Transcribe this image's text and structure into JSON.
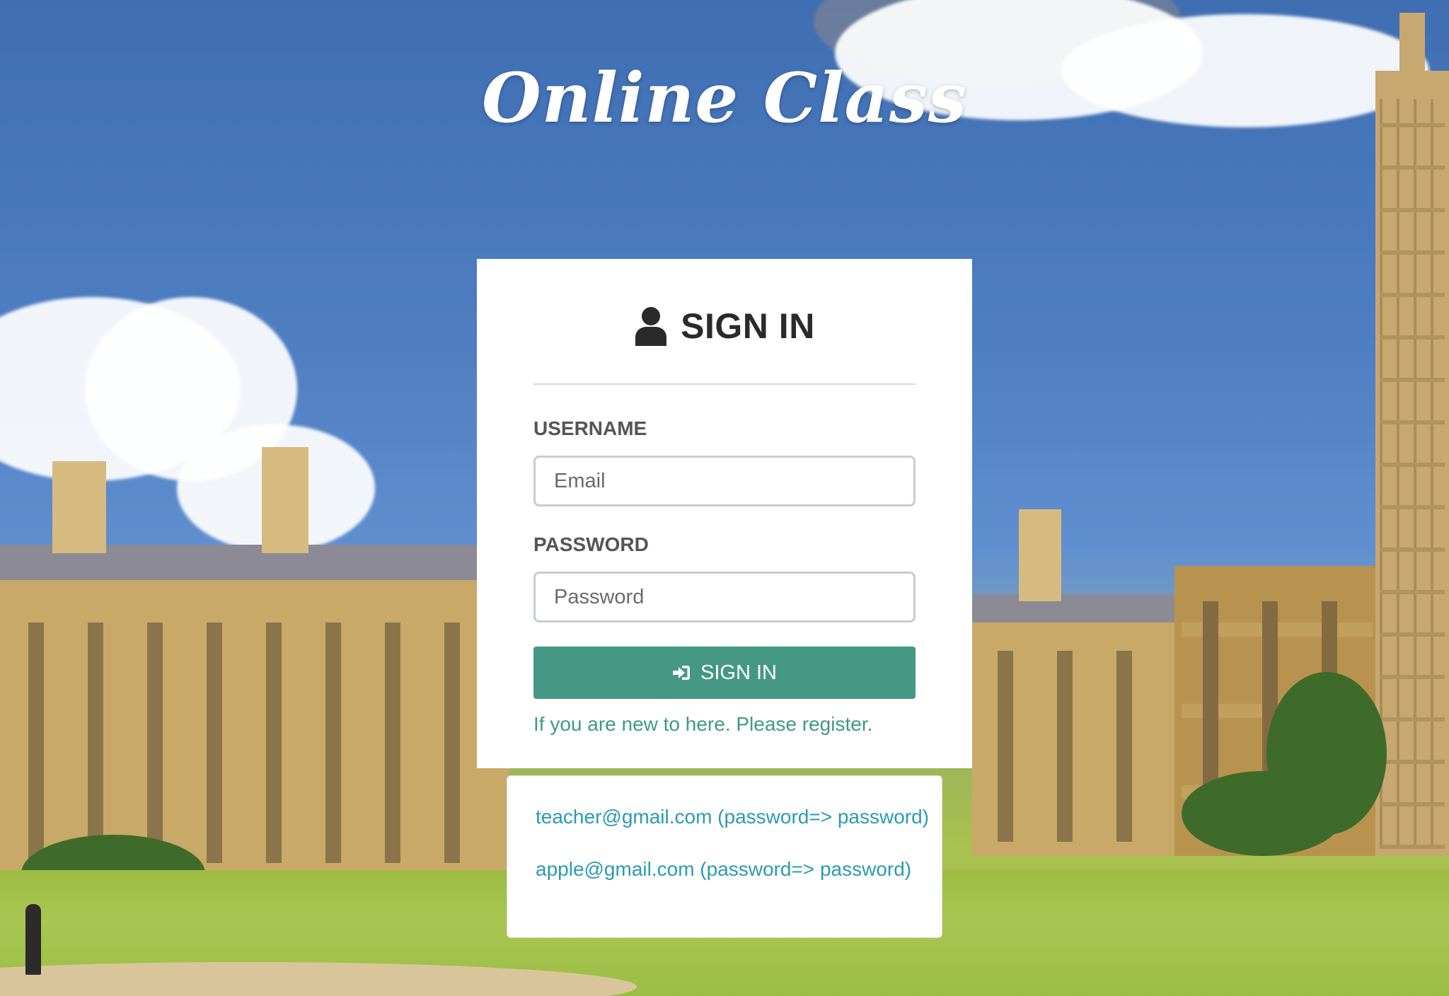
{
  "site": {
    "title": "Online Class"
  },
  "signin": {
    "title": "SIGN IN",
    "username_label": "USERNAME",
    "username_placeholder": "Email",
    "password_label": "PASSWORD",
    "password_placeholder": "Password",
    "button_label": "SIGN IN",
    "register_text": "If you are new to here. Please register."
  },
  "demo_accounts": [
    {
      "text": "teacher@gmail.com (password=> password)"
    },
    {
      "text": "apple@gmail.com (password=> password)"
    }
  ],
  "icons": {
    "header_icon": "user-icon",
    "button_icon": "sign-in-icon"
  },
  "colors": {
    "primary_button": "#459884",
    "register_link": "#3f9a82",
    "demo_link": "#2a9bb0"
  }
}
